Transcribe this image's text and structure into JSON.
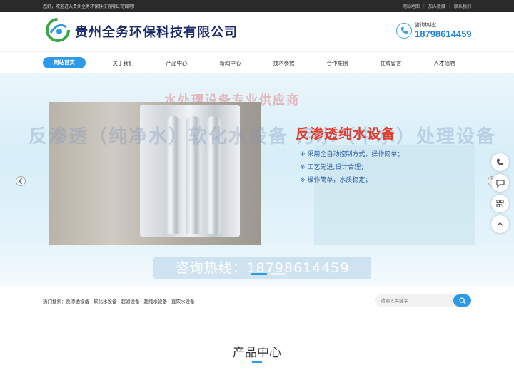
{
  "topbar": {
    "welcome": "您好，欢迎进入贵州全务环保科技有限公司官网！",
    "links": [
      "网站地图",
      "加入收藏",
      "联系我们"
    ]
  },
  "header": {
    "company": "贵州全务环保科技有限公司",
    "hotline_label": "咨询热线：",
    "hotline_number": "18798614459"
  },
  "nav": {
    "items": [
      "网站首页",
      "关于我们",
      "产品中心",
      "新闻中心",
      "技术参数",
      "合作案例",
      "在线留言",
      "人才招聘"
    ]
  },
  "banner": {
    "top_text": "水处理设备专业供应商",
    "ghost_text": "反渗透（纯净水）软化水设备  污水（中水）处理设备",
    "title": "反渗透纯水设备",
    "features": [
      "※  采用全自动控制方式，操作简单；",
      "※  工艺先进,设计合理；",
      "※  操作简单，水质稳定；"
    ],
    "call": "咨询热线：18798614459"
  },
  "search": {
    "hot_label": "热门搜索：",
    "keywords": [
      "反渗透设备",
      "软化水设备",
      "超滤设备",
      "超纯水设备",
      "直饮水设备"
    ],
    "placeholder": "请输入关键字"
  },
  "section": {
    "title": "产品中心"
  },
  "colors": {
    "accent": "#2d9ae8",
    "brand": "#1b2a6a",
    "banner_title": "#e23b2e"
  }
}
